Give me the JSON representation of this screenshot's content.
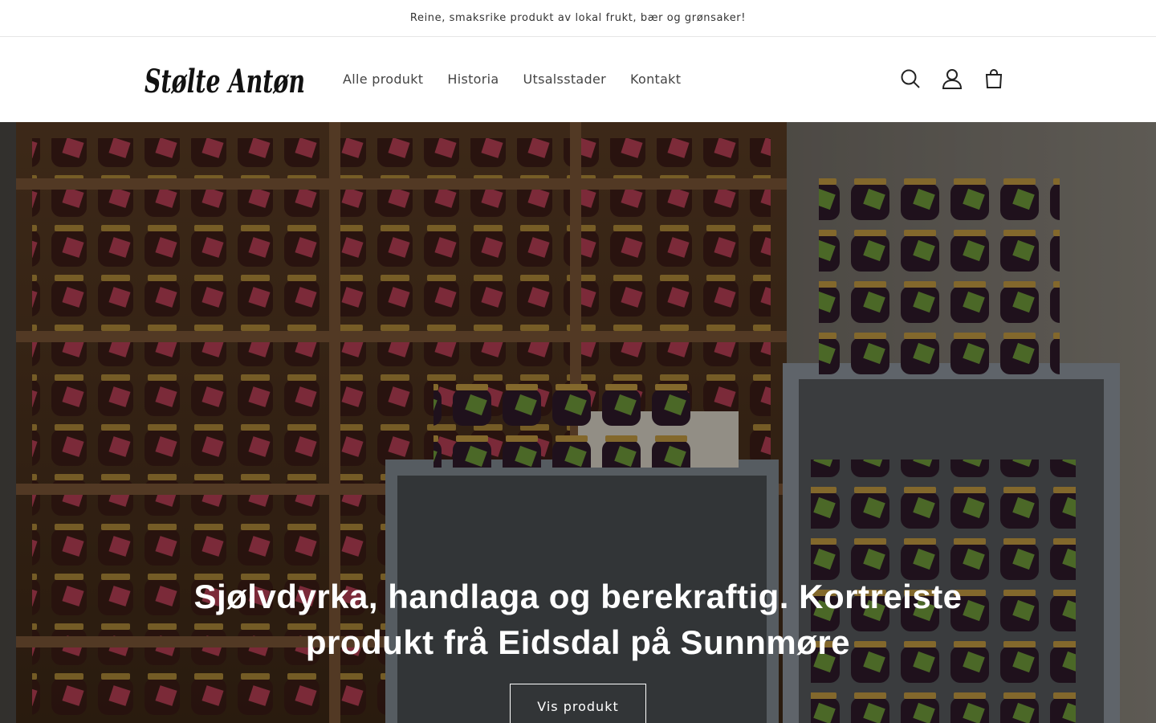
{
  "announcement": {
    "text": "Reine, smaksrike produkt av lokal frukt, bær og grønsaker!"
  },
  "header": {
    "logo_text": "Stølte Antøn",
    "nav": [
      {
        "label": "Alle produkt"
      },
      {
        "label": "Historia"
      },
      {
        "label": "Utsalsstader"
      },
      {
        "label": "Kontakt"
      }
    ],
    "icons": [
      "search-icon",
      "account-icon",
      "cart-icon"
    ]
  },
  "hero": {
    "heading": "Sjølvdyrka, handlaga og berekraftig. Kortreiste produkt frå Eidsdal på Sunnmøre",
    "button_label": "Vis produkt"
  },
  "colors": {
    "text": "#121212",
    "overlay": "#000000",
    "hero_text": "#ffffff"
  }
}
